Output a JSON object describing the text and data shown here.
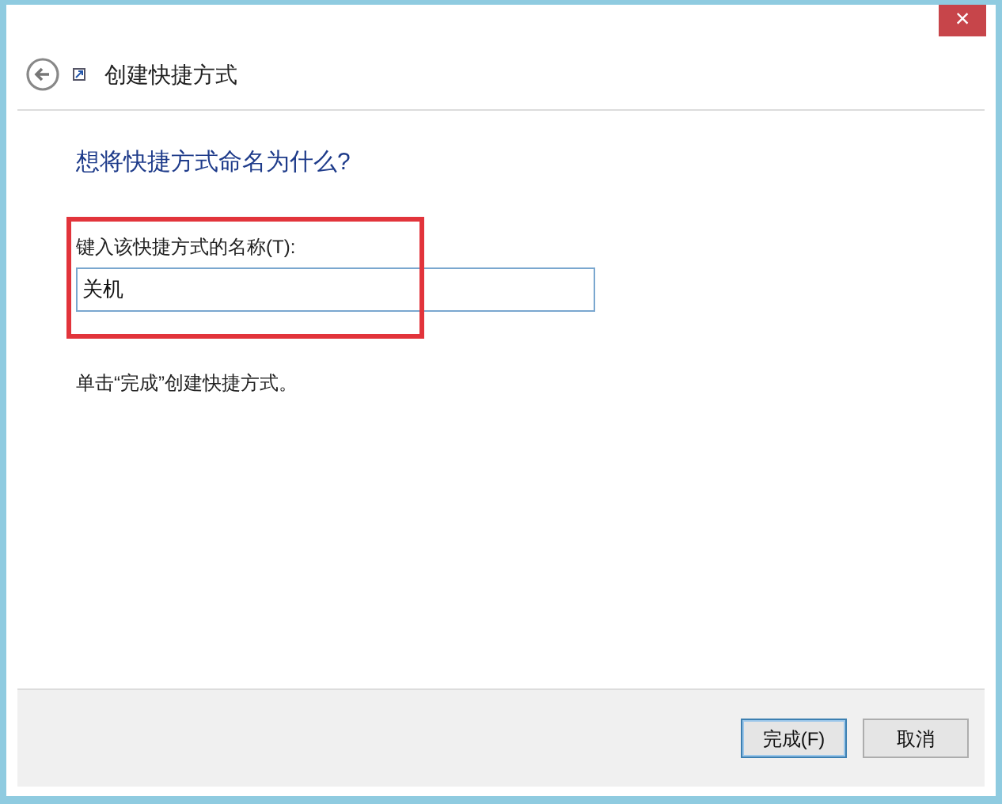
{
  "window": {
    "close_label": "×"
  },
  "header": {
    "title": "创建快捷方式"
  },
  "heading": "想将快捷方式命名为什么?",
  "name_field": {
    "label": "键入该快捷方式的名称(T):",
    "value": "关机"
  },
  "hint": "单击“完成”创建快捷方式。",
  "buttons": [
    {
      "label": "完成(F)",
      "kind": "primary"
    },
    {
      "label": "取消",
      "kind": "normal"
    }
  ]
}
